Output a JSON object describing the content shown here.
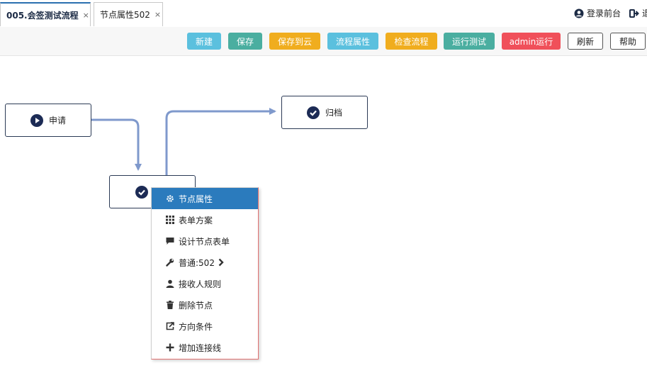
{
  "tabs": [
    {
      "label": "005.会签测试流程",
      "close": "×"
    },
    {
      "label": "节点属性502",
      "close": "×"
    }
  ],
  "header": {
    "login_front": "登录前台",
    "exit_label": "退"
  },
  "toolbar": {
    "buttons": [
      {
        "label": "新建",
        "color": "#5bc0de"
      },
      {
        "label": "保存",
        "color": "#4aaea0"
      },
      {
        "label": "保存到云",
        "color": "#f0ad1e"
      },
      {
        "label": "流程属性",
        "color": "#5bc0de"
      },
      {
        "label": "检查流程",
        "color": "#f0ad1e"
      },
      {
        "label": "运行测试",
        "color": "#4aaea0"
      },
      {
        "label": "admin运行",
        "color": "#f0505a"
      },
      {
        "label": "刷新",
        "color": "#ffffff"
      },
      {
        "label": "帮助",
        "color": "#ffffff"
      }
    ]
  },
  "nodes": {
    "apply": {
      "label": "申请",
      "icon": "play-circle-icon"
    },
    "archive": {
      "label": "归档",
      "icon": "check-circle-icon"
    },
    "countersign": {
      "label": "",
      "icon": "check-circle-icon"
    }
  },
  "context_menu": {
    "items": [
      {
        "label": "节点属性",
        "icon": "gear-icon"
      },
      {
        "label": "表单方案",
        "icon": "grid-icon"
      },
      {
        "label": "设计节点表单",
        "icon": "comment-icon"
      },
      {
        "label": "普通:502",
        "icon": "wrench-icon",
        "submenu": "chevron-right-icon"
      },
      {
        "label": "接收人规则",
        "icon": "user-icon"
      },
      {
        "label": "删除节点",
        "icon": "trash-icon"
      },
      {
        "label": "方向条件",
        "icon": "share-icon"
      },
      {
        "label": "增加连接线",
        "icon": "plus-icon"
      }
    ]
  },
  "colors": {
    "accent": "#2b7bbd",
    "connector": "#7f99cc",
    "node_icon": "#1c2b55"
  }
}
